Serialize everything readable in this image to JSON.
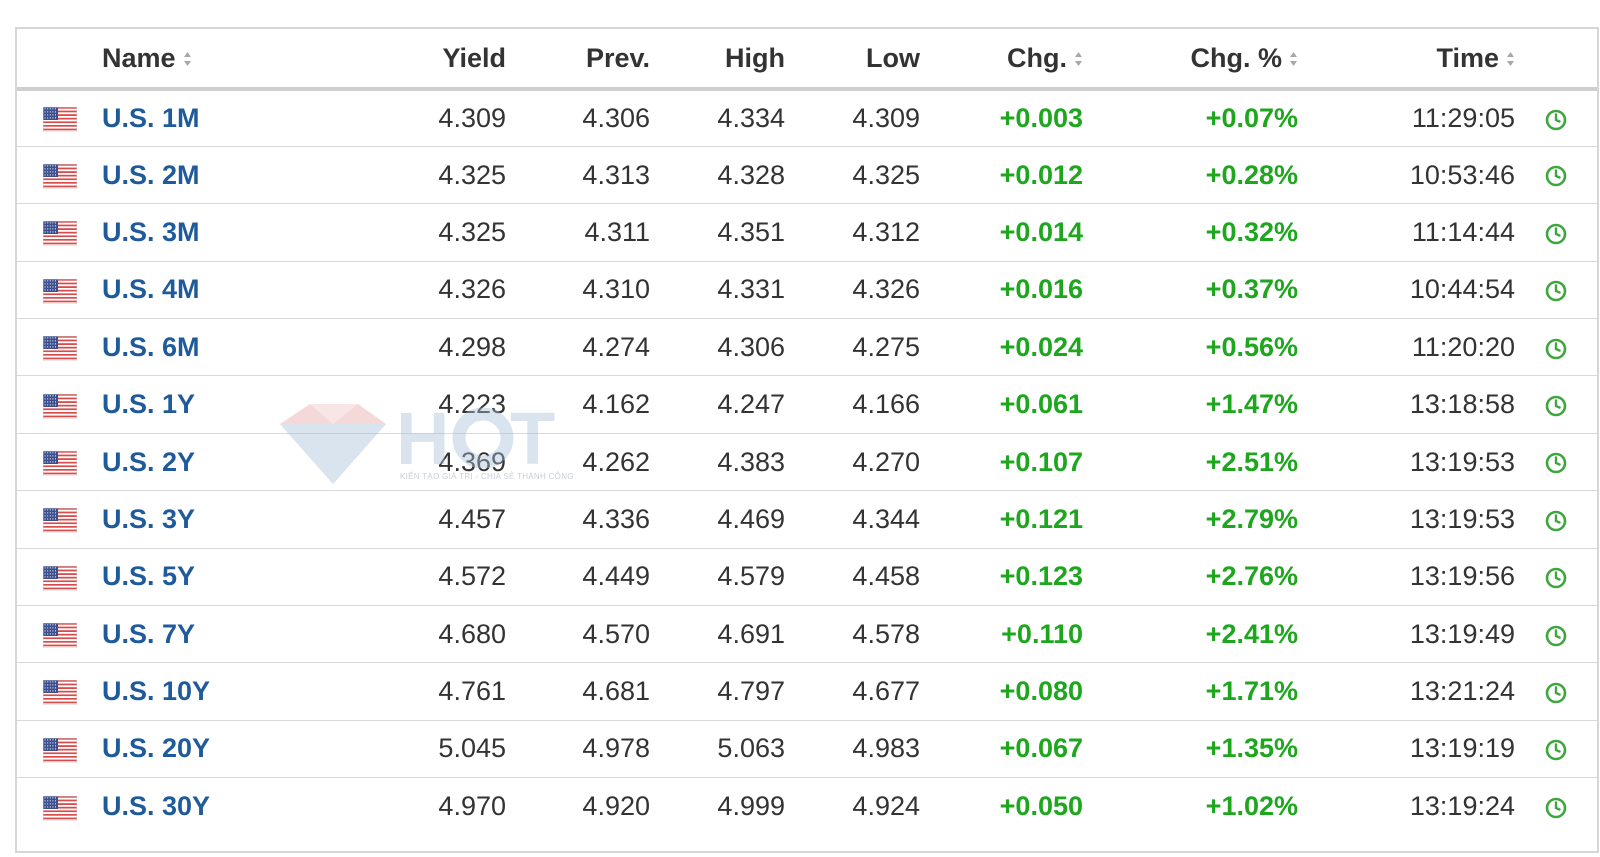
{
  "colors": {
    "name_link": "#1f5b9b",
    "positive": "#1ea61e",
    "clock": "#3da63d",
    "header_text": "#333333"
  },
  "header": {
    "name": "Name",
    "yield": "Yield",
    "prev": "Prev.",
    "high": "High",
    "low": "Low",
    "chg": "Chg.",
    "chg_pct": "Chg. %",
    "time": "Time"
  },
  "watermark": {
    "logo": "HCT",
    "tagline": "KIẾN TẠO GIÁ TRỊ - CHIA SẺ THÀNH CÔNG"
  },
  "rows": [
    {
      "flag": "us-flag-icon",
      "name": "U.S. 1M",
      "yield": "4.309",
      "prev": "4.306",
      "high": "4.334",
      "low": "4.309",
      "chg": "+0.003",
      "chg_pct": "+0.07%",
      "time": "11:29:05",
      "status_icon": "clock-icon"
    },
    {
      "flag": "us-flag-icon",
      "name": "U.S. 2M",
      "yield": "4.325",
      "prev": "4.313",
      "high": "4.328",
      "low": "4.325",
      "chg": "+0.012",
      "chg_pct": "+0.28%",
      "time": "10:53:46",
      "status_icon": "clock-icon"
    },
    {
      "flag": "us-flag-icon",
      "name": "U.S. 3M",
      "yield": "4.325",
      "prev": "4.311",
      "high": "4.351",
      "low": "4.312",
      "chg": "+0.014",
      "chg_pct": "+0.32%",
      "time": "11:14:44",
      "status_icon": "clock-icon"
    },
    {
      "flag": "us-flag-icon",
      "name": "U.S. 4M",
      "yield": "4.326",
      "prev": "4.310",
      "high": "4.331",
      "low": "4.326",
      "chg": "+0.016",
      "chg_pct": "+0.37%",
      "time": "10:44:54",
      "status_icon": "clock-icon"
    },
    {
      "flag": "us-flag-icon",
      "name": "U.S. 6M",
      "yield": "4.298",
      "prev": "4.274",
      "high": "4.306",
      "low": "4.275",
      "chg": "+0.024",
      "chg_pct": "+0.56%",
      "time": "11:20:20",
      "status_icon": "clock-icon"
    },
    {
      "flag": "us-flag-icon",
      "name": "U.S. 1Y",
      "yield": "4.223",
      "prev": "4.162",
      "high": "4.247",
      "low": "4.166",
      "chg": "+0.061",
      "chg_pct": "+1.47%",
      "time": "13:18:58",
      "status_icon": "clock-icon"
    },
    {
      "flag": "us-flag-icon",
      "name": "U.S. 2Y",
      "yield": "4.369",
      "prev": "4.262",
      "high": "4.383",
      "low": "4.270",
      "chg": "+0.107",
      "chg_pct": "+2.51%",
      "time": "13:19:53",
      "status_icon": "clock-icon"
    },
    {
      "flag": "us-flag-icon",
      "name": "U.S. 3Y",
      "yield": "4.457",
      "prev": "4.336",
      "high": "4.469",
      "low": "4.344",
      "chg": "+0.121",
      "chg_pct": "+2.79%",
      "time": "13:19:53",
      "status_icon": "clock-icon"
    },
    {
      "flag": "us-flag-icon",
      "name": "U.S. 5Y",
      "yield": "4.572",
      "prev": "4.449",
      "high": "4.579",
      "low": "4.458",
      "chg": "+0.123",
      "chg_pct": "+2.76%",
      "time": "13:19:56",
      "status_icon": "clock-icon"
    },
    {
      "flag": "us-flag-icon",
      "name": "U.S. 7Y",
      "yield": "4.680",
      "prev": "4.570",
      "high": "4.691",
      "low": "4.578",
      "chg": "+0.110",
      "chg_pct": "+2.41%",
      "time": "13:19:49",
      "status_icon": "clock-icon"
    },
    {
      "flag": "us-flag-icon",
      "name": "U.S. 10Y",
      "yield": "4.761",
      "prev": "4.681",
      "high": "4.797",
      "low": "4.677",
      "chg": "+0.080",
      "chg_pct": "+1.71%",
      "time": "13:21:24",
      "status_icon": "clock-icon"
    },
    {
      "flag": "us-flag-icon",
      "name": "U.S. 20Y",
      "yield": "5.045",
      "prev": "4.978",
      "high": "5.063",
      "low": "4.983",
      "chg": "+0.067",
      "chg_pct": "+1.35%",
      "time": "13:19:19",
      "status_icon": "clock-icon"
    },
    {
      "flag": "us-flag-icon",
      "name": "U.S. 30Y",
      "yield": "4.970",
      "prev": "4.920",
      "high": "4.999",
      "low": "4.924",
      "chg": "+0.050",
      "chg_pct": "+1.02%",
      "time": "13:19:24",
      "status_icon": "clock-icon"
    }
  ]
}
